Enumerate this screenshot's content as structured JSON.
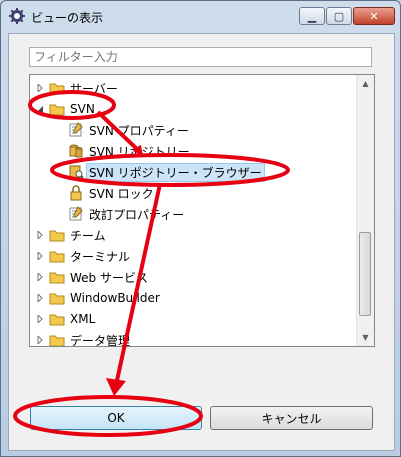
{
  "window": {
    "title": "ビューの表示",
    "min_icon": "minimize-icon",
    "max_icon": "maximize-icon",
    "close_icon": "close-icon"
  },
  "filter": {
    "placeholder": "フィルター入力"
  },
  "tree": {
    "items": [
      {
        "label": "サーバー",
        "expanded": false,
        "icon": "folder-icon"
      },
      {
        "label": "SVN",
        "expanded": true,
        "icon": "folder-icon"
      },
      {
        "label": "SVN プロパティー",
        "icon": "svn-properties-icon"
      },
      {
        "label": "SVN リポジトリー",
        "icon": "svn-repository-icon"
      },
      {
        "label": "SVN リポジトリー・ブラウザー",
        "icon": "svn-repository-browser-icon",
        "selected": true
      },
      {
        "label": "SVN ロック",
        "icon": "lock-icon"
      },
      {
        "label": "改訂プロパティー",
        "icon": "revision-properties-icon"
      },
      {
        "label": "チーム",
        "expanded": false,
        "icon": "folder-icon"
      },
      {
        "label": "ターミナル",
        "expanded": false,
        "icon": "folder-icon"
      },
      {
        "label": "Web サービス",
        "expanded": false,
        "icon": "folder-icon"
      },
      {
        "label": "WindowBuilder",
        "expanded": false,
        "icon": "folder-icon"
      },
      {
        "label": "XML",
        "expanded": false,
        "icon": "folder-icon"
      },
      {
        "label": "データ管理",
        "expanded": false,
        "icon": "folder-icon"
      }
    ]
  },
  "buttons": {
    "ok": "OK",
    "cancel": "キャンセル"
  },
  "colors": {
    "annotation": "#e60012",
    "selection": "#cce4f7"
  }
}
